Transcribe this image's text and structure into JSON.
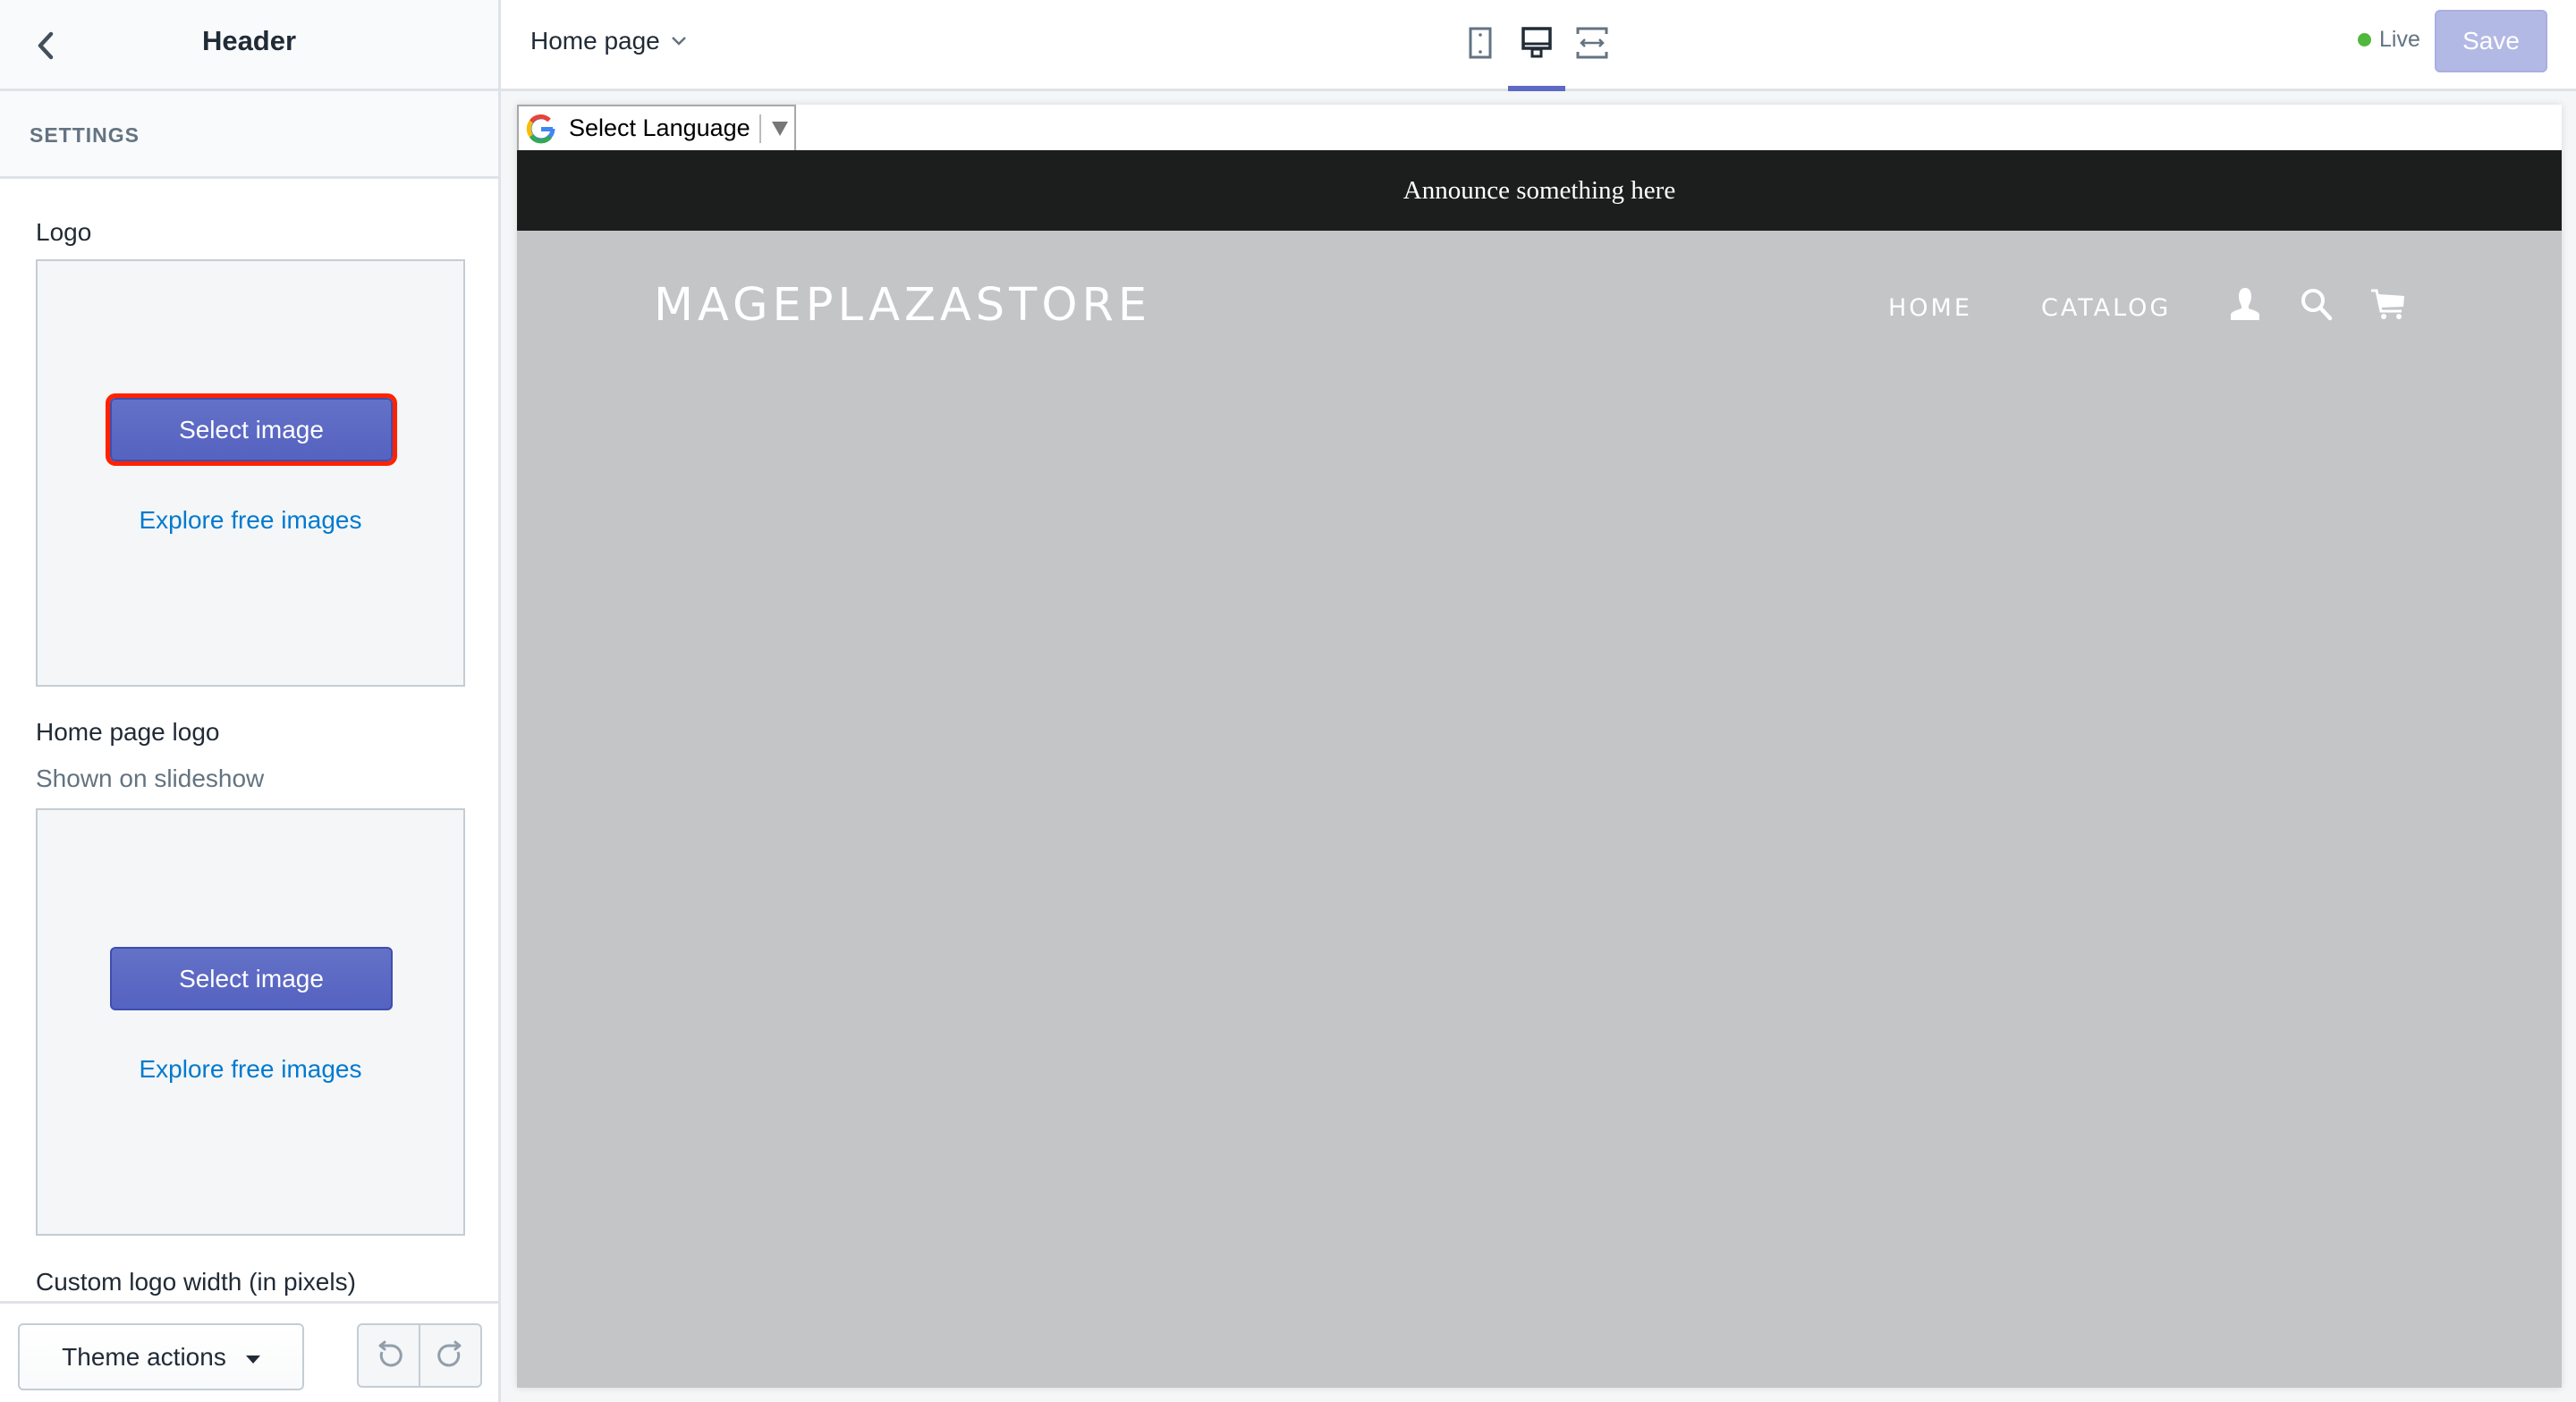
{
  "sidebar": {
    "title": "Header",
    "section_heading": "SETTINGS",
    "logo": {
      "label": "Logo",
      "select_button": "Select image",
      "explore_link": "Explore free images"
    },
    "home_page_logo": {
      "label": "Home page logo",
      "help_text": "Shown on slideshow",
      "select_button": "Select image",
      "explore_link": "Explore free images"
    },
    "custom_logo_width_label": "Custom logo width (in pixels)",
    "footer": {
      "theme_actions_label": "Theme actions"
    }
  },
  "topbar": {
    "page_selector": "Home page",
    "devices": [
      "mobile",
      "desktop",
      "full-width"
    ],
    "active_device": "desktop",
    "status": "Live",
    "status_color": "#50b83c",
    "save_label": "Save"
  },
  "preview": {
    "language_selector": "Select Language",
    "announcement": "Announce something here",
    "store_name": "MAGEPLAZASTORE",
    "nav": [
      "HOME",
      "CATALOG"
    ],
    "icons": [
      "account-icon",
      "search-icon",
      "cart-icon"
    ]
  },
  "colors": {
    "accent": "#5c6ac4",
    "link": "#007ace",
    "highlight_outline": "#ff2200"
  }
}
